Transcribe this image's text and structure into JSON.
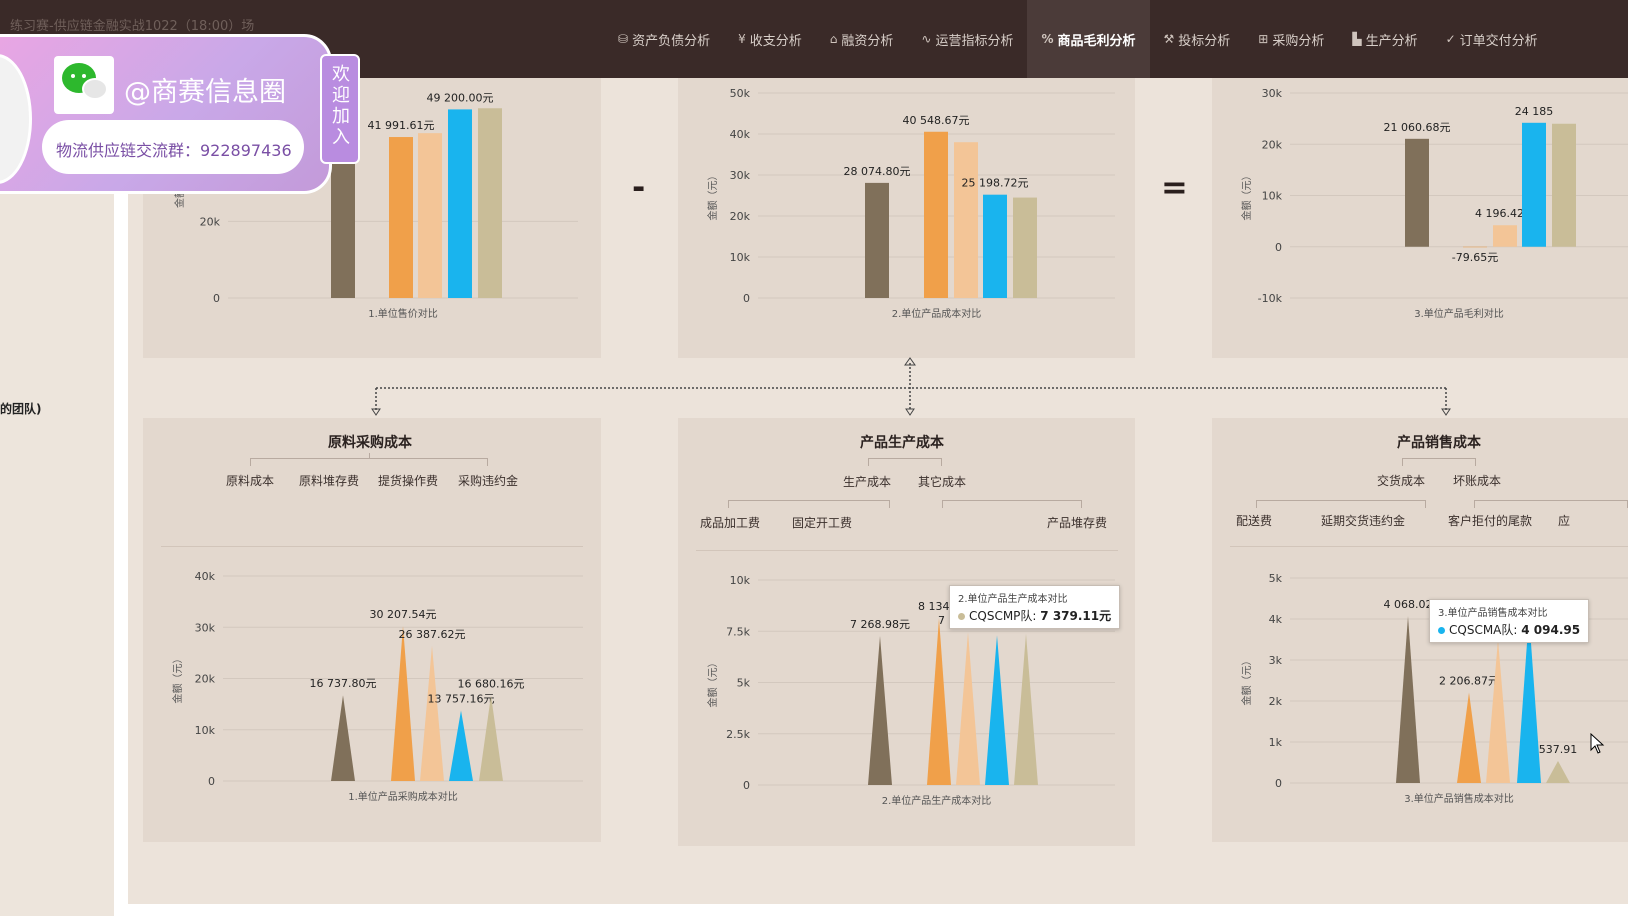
{
  "app": {
    "title": "练习赛-供应链金融实战1022（18:00）场"
  },
  "nav": {
    "items": [
      {
        "label": "资产负债分析",
        "icon": "database-icon",
        "glyph": "⛁"
      },
      {
        "label": "收支分析",
        "icon": "yen-icon",
        "glyph": "¥"
      },
      {
        "label": "融资分析",
        "icon": "bank-icon",
        "glyph": "⌂"
      },
      {
        "label": "运营指标分析",
        "icon": "pulse-icon",
        "glyph": "∿"
      },
      {
        "label": "商品毛利分析",
        "icon": "percent-icon",
        "glyph": "%"
      },
      {
        "label": "投标分析",
        "icon": "gavel-icon",
        "glyph": "⚒"
      },
      {
        "label": "采购分析",
        "icon": "cart-icon",
        "glyph": "⊞"
      },
      {
        "label": "生产分析",
        "icon": "factory-icon",
        "glyph": "▙"
      },
      {
        "label": "订单交付分析",
        "icon": "truck-icon",
        "glyph": "✓"
      }
    ],
    "active": "商品毛利分析"
  },
  "sidebar": {
    "team_fragment": "的团队)"
  },
  "colors": {
    "series": [
      "#80705a",
      "#f0a04a",
      "#f3c597",
      "#19b4ee",
      "#c9bd98"
    ],
    "panel": "#e3d8ce",
    "nav_bg": "#3a2a28"
  },
  "operators": {
    "minus": "-",
    "equals": "="
  },
  "chart_data": [
    {
      "type": "bar",
      "xlabel": "1.单位售价对比",
      "ylabel": "金额（元）",
      "ylim": [
        0,
        60000
      ],
      "ticks": [
        "0",
        "20k"
      ],
      "values": [
        59800,
        41991.61,
        43000,
        49200.0,
        49500
      ],
      "labels": [
        "元",
        "41 991.61元",
        "",
        "49 200.00元",
        ""
      ]
    },
    {
      "type": "bar",
      "xlabel": "2.单位产品成本对比",
      "ylabel": "金额（元）",
      "ylim": [
        0,
        50000
      ],
      "ticks": [
        "0",
        "10k",
        "20k",
        "30k",
        "40k",
        "50k"
      ],
      "values": [
        28074.8,
        40548.67,
        38000,
        25198.72,
        24500
      ],
      "labels": [
        "28 074.80元",
        "40 548.67元",
        "",
        "25 198.72元",
        ""
      ]
    },
    {
      "type": "bar",
      "xlabel": "3.单位产品毛利对比",
      "ylabel": "金额（元）",
      "ylim": [
        -10000,
        30000
      ],
      "ticks": [
        "-10k",
        "0",
        "10k",
        "20k",
        "30k"
      ],
      "values": [
        21060.68,
        -79.65,
        4196.42,
        24185,
        24000
      ],
      "labels": [
        "21 060.68元",
        "-79.65元",
        "4 196.42元",
        "24 185",
        ""
      ]
    },
    {
      "type": "bar",
      "shape": "pictorial-triangle",
      "xlabel": "1.单位产品采购成本对比",
      "ylabel": "金额（元）",
      "ylim": [
        0,
        40000
      ],
      "ticks": [
        "0",
        "10k",
        "20k",
        "30k",
        "40k"
      ],
      "values": [
        16737.8,
        30207.54,
        26387.62,
        13757.16,
        16680.16
      ],
      "labels": [
        "16 737.80元",
        "30 207.54元",
        "26 387.62元",
        "13 757.16元",
        "16 680.16元"
      ]
    },
    {
      "type": "bar",
      "shape": "pictorial-triangle",
      "xlabel": "2.单位产品生产成本对比",
      "ylabel": "金额（元）",
      "ylim": [
        0,
        10000
      ],
      "ticks": [
        "0",
        "2.5k",
        "5k",
        "7.5k",
        "10k"
      ],
      "values": [
        7268.98,
        8134.2,
        7456.26,
        7300,
        7379.11
      ],
      "labels": [
        "7 268.98元",
        "8 134.2",
        "7 456.26元",
        "",
        ""
      ]
    },
    {
      "type": "bar",
      "shape": "pictorial-triangle",
      "xlabel": "3.单位产品销售成本对比",
      "ylabel": "金额（元）",
      "ylim": [
        0,
        5000
      ],
      "ticks": [
        "0",
        "1k",
        "2k",
        "3k",
        "4k",
        "5k"
      ],
      "values": [
        4068.02,
        2206.87,
        3500,
        4094.95,
        537.91
      ],
      "labels": [
        "4 068.02",
        "2 206.87元",
        "",
        "",
        "537.91"
      ]
    }
  ],
  "breakdown": {
    "purchase": {
      "title": "原料采购成本",
      "items": [
        "原料成本",
        "原料堆存费",
        "提货操作费",
        "采购违约金"
      ]
    },
    "production": {
      "title": "产品生产成本",
      "groups": [
        "生产成本",
        "其它成本"
      ],
      "items": [
        "成品加工费",
        "固定开工费",
        "产品堆存费"
      ]
    },
    "sales": {
      "title": "产品销售成本",
      "groups": [
        "交货成本",
        "坏账成本"
      ],
      "items": [
        "配送费",
        "延期交货违约金",
        "客户拒付的尾款",
        "应"
      ]
    }
  },
  "tooltips": {
    "production": {
      "title": "2.单位产品生产成本对比",
      "team": "CQSCMP队:",
      "value": "7 379.11元",
      "color": "#c9bd98"
    },
    "sales": {
      "title": "3.单位产品销售成本对比",
      "team": "CQSCMA队:",
      "value": "4 094.95",
      "color": "#19b4ee"
    }
  },
  "promo": {
    "handle": "@商赛信息圈",
    "group": "物流供应链交流群：922897436",
    "join": "欢迎加入"
  }
}
